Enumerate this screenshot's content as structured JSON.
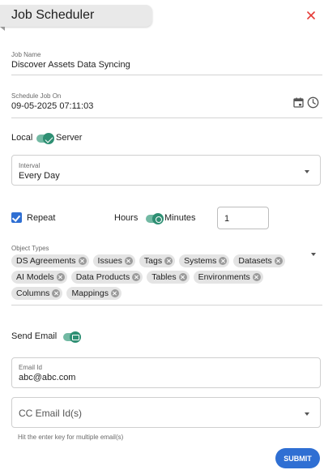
{
  "header": {
    "title": "Job Scheduler",
    "close_icon": "close-icon",
    "accent": "#e53935"
  },
  "job_name": {
    "label": "Job Name",
    "value": "Discover Assets Data Syncing"
  },
  "schedule": {
    "label": "Schedule Job On",
    "value": "09-05-2025 07:11:03",
    "icons": [
      "calendar-icon",
      "clock-icon"
    ]
  },
  "location": {
    "left_label": "Local",
    "right_label": "Server",
    "selected": "Server"
  },
  "interval": {
    "label": "Interval",
    "value": "Every Day"
  },
  "repeat": {
    "label": "Repeat",
    "checked": true,
    "hours_label": "Hours",
    "minutes_label": "Minutes",
    "unit_selected": "Minutes",
    "value": "1"
  },
  "object_types": {
    "label": "Object Types",
    "rows": [
      [
        "DS Agreements",
        "Issues",
        "Tags",
        "Systems",
        "Datasets"
      ],
      [
        "AI Models",
        "Data Products",
        "Tables",
        "Environments"
      ],
      [
        "Columns",
        "Mappings"
      ]
    ]
  },
  "send_email": {
    "label": "Send Email",
    "enabled": true
  },
  "email": {
    "label": "Email Id",
    "value": "abc@abc.com"
  },
  "cc_email": {
    "placeholder": "CC Email Id(s)",
    "hint": "Hit the enter key for multiple email(s)"
  },
  "submit": {
    "label": "SUBMIT",
    "color": "#2f6fd3"
  },
  "colors": {
    "toggle_on": "#2e8f73",
    "checkbox": "#2f6fd3"
  }
}
